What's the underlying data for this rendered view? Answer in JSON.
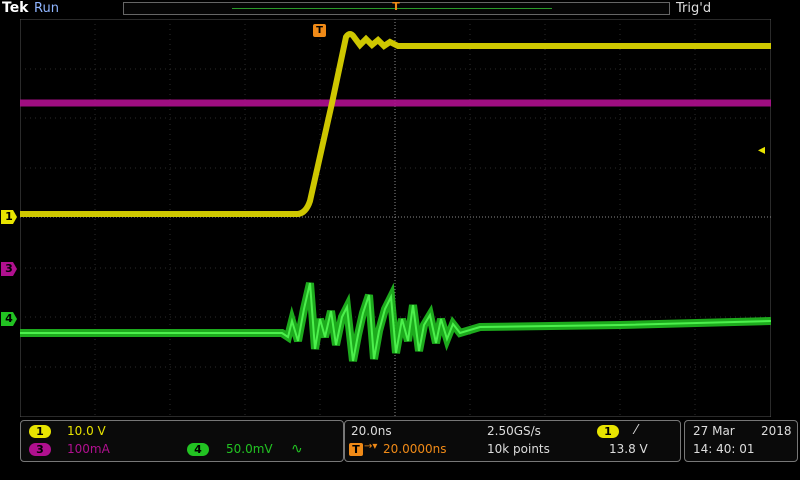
{
  "header": {
    "brand": "Tek",
    "run_state": "Run",
    "trigger_state": "Trig'd"
  },
  "markers": {
    "ch1": "1",
    "ch3": "3",
    "ch4": "4",
    "trigger_position": "T",
    "top_trigger": "T"
  },
  "channels": {
    "ch1": {
      "number": "1",
      "scale": "10.0 V",
      "color": "#e8e400"
    },
    "ch3": {
      "number": "3",
      "scale": "100mA",
      "color": "#b0108f"
    },
    "ch4": {
      "number": "4",
      "scale": "50.0mV",
      "coupling_symbol": "∿",
      "color": "#22c322"
    }
  },
  "timebase": {
    "scale": "20.0ns",
    "sample_rate": "2.50GS/s",
    "delay": "20.0000ns",
    "record_length": "10k points"
  },
  "trigger": {
    "source": "1",
    "slope_symbol": "⁄",
    "level": "13.8 V"
  },
  "datetime": {
    "date_day_month": "27 Mar",
    "year": "2018",
    "time": "14: 40: 01"
  }
}
